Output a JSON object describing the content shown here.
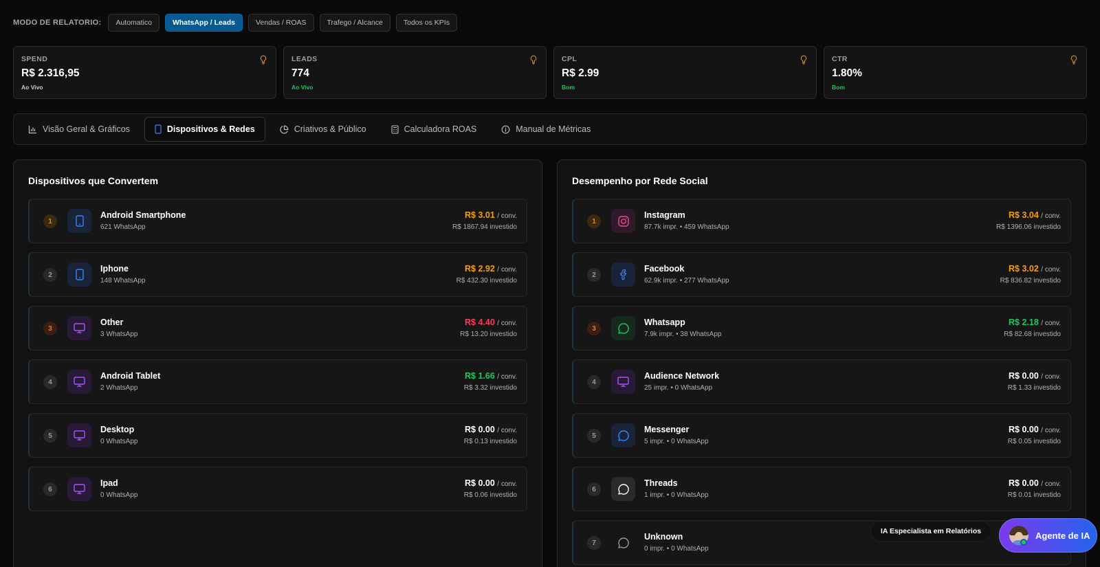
{
  "mode_bar": {
    "label": "MODO DE RELATORIO:",
    "buttons": [
      {
        "label": "Automatico",
        "active": false
      },
      {
        "label": "WhatsApp / Leads",
        "active": true
      },
      {
        "label": "Vendas / ROAS",
        "active": false
      },
      {
        "label": "Trafego / Alcance",
        "active": false
      },
      {
        "label": "Todos os KPIs",
        "active": false
      }
    ]
  },
  "kpis": [
    {
      "title": "SPEND",
      "value": "R$ 2.316,95",
      "sub": "Ao Vivo"
    },
    {
      "title": "LEADS",
      "value": "774",
      "sub": "Ao Vivo"
    },
    {
      "title": "CPL",
      "value": "R$ 2.99",
      "sub": "Bom"
    },
    {
      "title": "CTR",
      "value": "1.80%",
      "sub": "Bom"
    }
  ],
  "tabs": [
    {
      "label": "Visão Geral & Gráficos",
      "icon": "bar-chart-icon",
      "active": false
    },
    {
      "label": "Dispositivos & Redes",
      "icon": "smartphone-icon",
      "active": true
    },
    {
      "label": "Criativos & Público",
      "icon": "pie-chart-icon",
      "active": false
    },
    {
      "label": "Calculadora ROAS",
      "icon": "calculator-icon",
      "active": false
    },
    {
      "label": "Manual de Métricas",
      "icon": "info-icon",
      "active": false
    }
  ],
  "devices": {
    "title": "Dispositivos que Convertem",
    "rows": [
      {
        "rank": "1",
        "name": "Android Smartphone",
        "sub": "621 WhatsApp",
        "cost": "R$ 3.01",
        "unit": "/ conv.",
        "invested": "R$ 1867.94 investido",
        "icon": "smartphone-icon",
        "cost_color": "#f59e0b"
      },
      {
        "rank": "2",
        "name": "Iphone",
        "sub": "148 WhatsApp",
        "cost": "R$ 2.92",
        "unit": "/ conv.",
        "invested": "R$ 432.30 investido",
        "icon": "smartphone-icon",
        "cost_color": "#f59e0b"
      },
      {
        "rank": "3",
        "name": "Other",
        "sub": "3 WhatsApp",
        "cost": "R$ 4.40",
        "unit": "/ conv.",
        "invested": "R$ 13.20 investido",
        "icon": "monitor-icon",
        "cost_color": "#f43f5e"
      },
      {
        "rank": "4",
        "name": "Android Tablet",
        "sub": "2 WhatsApp",
        "cost": "R$ 1.66",
        "unit": "/ conv.",
        "invested": "R$ 3.32 investido",
        "icon": "monitor-icon",
        "cost_color": "#22c55e"
      },
      {
        "rank": "5",
        "name": "Desktop",
        "sub": "0 WhatsApp",
        "cost": "R$ 0.00",
        "unit": "/ conv.",
        "invested": "R$ 0.13 investido",
        "icon": "monitor-icon",
        "cost_color": "#ffffff"
      },
      {
        "rank": "6",
        "name": "Ipad",
        "sub": "0 WhatsApp",
        "cost": "R$ 0.00",
        "unit": "/ conv.",
        "invested": "R$ 0.06 investido",
        "icon": "monitor-icon",
        "cost_color": "#ffffff"
      }
    ]
  },
  "networks": {
    "title": "Desempenho por Rede Social",
    "rows": [
      {
        "rank": "1",
        "name": "Instagram",
        "sub": "87.7k impr. • 459 WhatsApp",
        "cost": "R$ 3.04",
        "unit": "/ conv.",
        "invested": "R$ 1396.06 investido",
        "icon": "instagram-icon",
        "cost_color": "#f59e0b"
      },
      {
        "rank": "2",
        "name": "Facebook",
        "sub": "62.9k impr. • 277 WhatsApp",
        "cost": "R$ 3.02",
        "unit": "/ conv.",
        "invested": "R$ 836.82 investido",
        "icon": "facebook-icon",
        "cost_color": "#f59e0b"
      },
      {
        "rank": "3",
        "name": "Whatsapp",
        "sub": "7.9k impr. • 38 WhatsApp",
        "cost": "R$ 2.18",
        "unit": "/ conv.",
        "invested": "R$ 82.68 investido",
        "icon": "whatsapp-icon",
        "cost_color": "#22c55e"
      },
      {
        "rank": "4",
        "name": "Audience Network",
        "sub": "25 impr. • 0 WhatsApp",
        "cost": "R$ 0.00",
        "unit": "/ conv.",
        "invested": "R$ 1.33 investido",
        "icon": "monitor-icon",
        "cost_color": "#ffffff"
      },
      {
        "rank": "5",
        "name": "Messenger",
        "sub": "5 impr. • 0 WhatsApp",
        "cost": "R$ 0.00",
        "unit": "/ conv.",
        "invested": "R$ 0.05 investido",
        "icon": "messenger-icon",
        "cost_color": "#ffffff"
      },
      {
        "rank": "6",
        "name": "Threads",
        "sub": "1 impr. • 0 WhatsApp",
        "cost": "R$ 0.00",
        "unit": "/ conv.",
        "invested": "R$ 0.01 investido",
        "icon": "threads-icon",
        "cost_color": "#ffffff"
      },
      {
        "rank": "7",
        "name": "Unknown",
        "sub": "0 impr. • 0 WhatsApp",
        "cost": "",
        "unit": "",
        "invested": "",
        "icon": "chat-icon",
        "cost_color": "#ffffff"
      }
    ]
  },
  "floating": {
    "ia_label": "IA Especialista em Relatórios",
    "agent_label": "Agente de IA"
  }
}
